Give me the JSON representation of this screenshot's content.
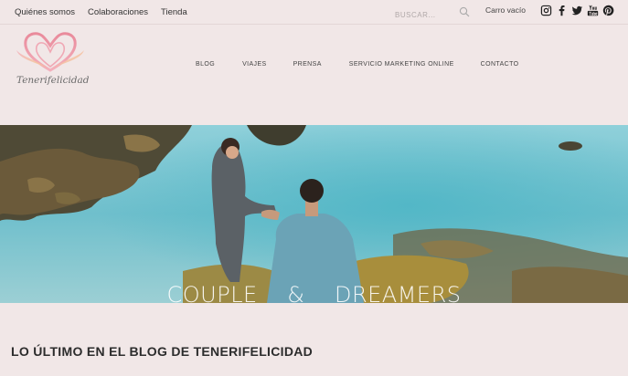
{
  "topbar": {
    "links": [
      "Quiénes somos",
      "Colaboraciones",
      "Tienda"
    ],
    "search_placeholder": "BUSCAR...",
    "cart_label": "Carro vacío",
    "social_icons": [
      "instagram-icon",
      "facebook-icon",
      "twitter-icon",
      "youtube-icon",
      "pinterest-icon"
    ]
  },
  "logo": {
    "text": "Tenerifelicidad",
    "heart_colors": [
      "#e98a9b",
      "#f3b0bc",
      "#f6d08a"
    ]
  },
  "nav": {
    "items": [
      "BLOG",
      "VIAJES",
      "PRENSA",
      "SERVICIO MARKETING ONLINE",
      "CONTACTO"
    ]
  },
  "hero": {
    "title": "COUPLE    &    DREAMERS"
  },
  "section": {
    "title": "LO ÚLTIMO EN EL BLOG DE TENERIFELICIDAD"
  },
  "colors": {
    "background": "#f1e7e7",
    "water": "#7fc6d2",
    "rock": "#6b5a3a"
  }
}
